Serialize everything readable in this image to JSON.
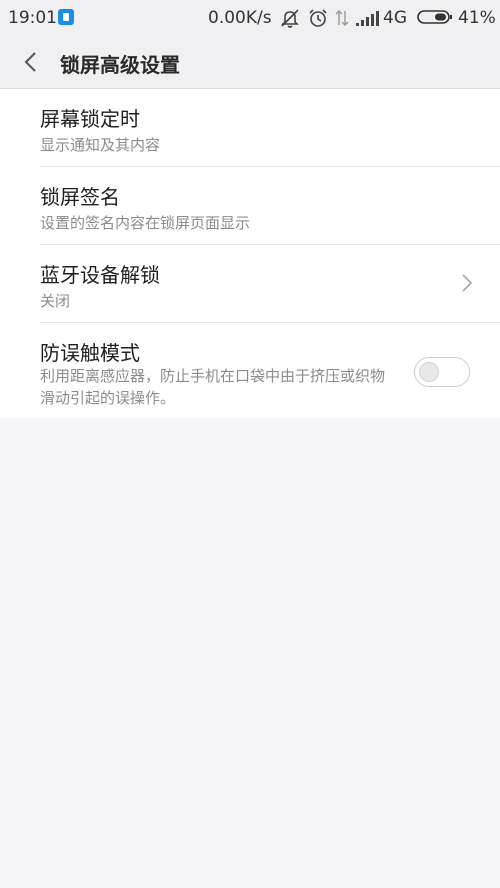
{
  "status_bar": {
    "time": "19:01",
    "net_speed": "0.00K/s",
    "network_type": "4G",
    "battery": "41%",
    "icons": [
      "app-notification-icon",
      "mute-icon",
      "alarm-icon",
      "data-arrows-icon",
      "signal-icon",
      "battery-icon"
    ]
  },
  "header": {
    "title": "锁屏高级设置",
    "back_icon": "chevron-left-icon"
  },
  "settings": [
    {
      "title": "屏幕锁定时",
      "subtitle": "显示通知及其内容",
      "control": "none"
    },
    {
      "title": "锁屏签名",
      "subtitle": "设置的签名内容在锁屏页面显示",
      "control": "none"
    },
    {
      "title": "蓝牙设备解锁",
      "subtitle": "关闭",
      "control": "chevron"
    },
    {
      "title": "防误触模式",
      "subtitle": "利用距离感应器，防止手机在口袋中由于挤压或织物滑动引起的误操作。",
      "control": "toggle",
      "toggle_on": false
    }
  ],
  "colors": {
    "background": "#f5f5f7",
    "header_bg": "#f0f0f2",
    "list_bg": "#ffffff",
    "title_text": "#1f1f1f",
    "subtitle_text": "#8c8c8c",
    "app_icon_blue": "#1a8cf0"
  }
}
